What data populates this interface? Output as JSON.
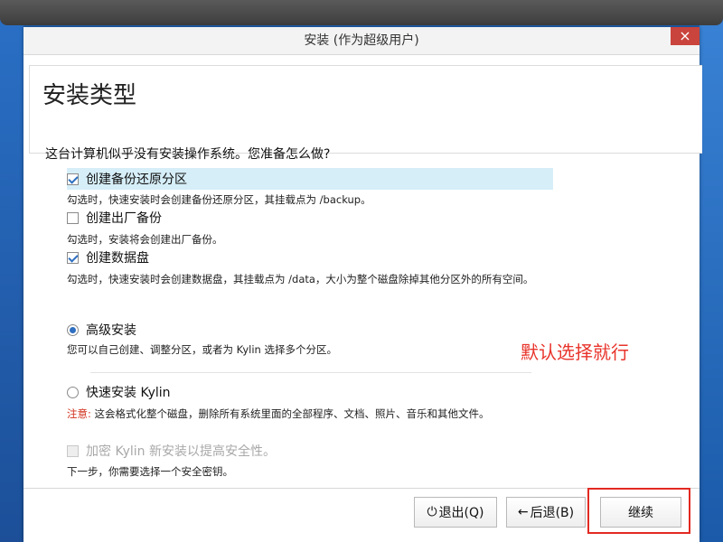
{
  "window": {
    "title": "安装 (作为超级用户)",
    "close_glyph": "×"
  },
  "page": {
    "title": "安装类型",
    "question": "这台计算机似乎没有安装操作系统。您准备怎么做?"
  },
  "options": {
    "backup_restore": {
      "label": "创建备份还原分区",
      "checked": true,
      "desc": "勾选时，快速安装时会创建备份还原分区，其挂载点为 /backup。"
    },
    "factory_backup": {
      "label": "创建出厂备份",
      "checked": false,
      "desc": "勾选时，安装将会创建出厂备份。"
    },
    "data_disk": {
      "label": "创建数据盘",
      "checked": true,
      "desc": "勾选时，快速安装时会创建数据盘，其挂载点为 /data，大小为整个磁盘除掉其他分区外的所有空间。"
    },
    "advanced": {
      "label": "高级安装",
      "selected": true,
      "desc": "您可以自己创建、调整分区，或者为 Kylin 选择多个分区。"
    },
    "quick": {
      "label": "快速安装 Kylin",
      "selected": false,
      "warn_label": "注意:",
      "desc": " 这会格式化整个磁盘，删除所有系统里面的全部程序、文档、照片、音乐和其他文件。"
    },
    "encrypt": {
      "label": "加密 Kylin 新安装以提高安全性。",
      "enabled": false,
      "desc": "下一步，你需要选择一个安全密钥。"
    }
  },
  "annotation": "默认选择就行",
  "buttons": {
    "quit": "退出(Q)",
    "quit_icon": "⏻",
    "back": "后退(B)",
    "back_icon": "←",
    "continue": "继续"
  },
  "colors": {
    "highlight": "#d6eef8",
    "annotation": "#e8332a",
    "accent": "#2e6fc0"
  }
}
